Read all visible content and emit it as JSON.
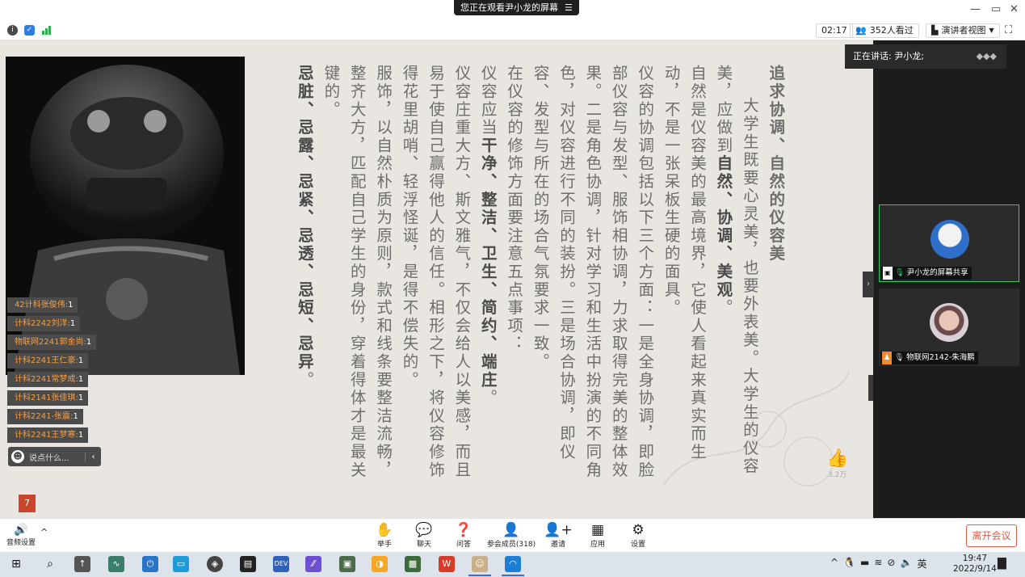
{
  "titlebar": {
    "share_notice": "您正在观看尹小龙的屏幕",
    "menu_glyph": "☰",
    "window_controls": [
      "—",
      "▭",
      "✕"
    ]
  },
  "toolbar": {
    "timer": "02:17",
    "viewers": "352人看过",
    "view_mode": "演讲者视图",
    "icons": [
      "info-icon",
      "shield-icon",
      "signal-icon",
      "fullscreen-icon"
    ],
    "colors": {
      "info": "#4a4a4a",
      "shield": "#2f7de1",
      "signal": "#2dae4f"
    }
  },
  "slide": {
    "title": "追求协调、自然的仪容美",
    "para1": [
      "大学生既要心灵美，也要外表美。大学生的仪容美，应做到",
      "自然、协调、美观",
      "。"
    ],
    "para2": "自然是仪容美的最高境界，它使人看起来真实而生动，不是一张呆板生硬的面具。",
    "para3": "仪容的协调包括以下三个方面：一是全身协调，即脸部仪容与发型、服饰相协调，力求取得完美的整体效果。二是角色协调，针对学习和生活中扮演的不同角色，对仪容进行不同的装扮。三是场合协调，即仪容、发型与所在的场合气氛要求一致。",
    "para4": "在仪容的修饰方面要注意五点事项：",
    "para5": [
      "仪容应当",
      "干净、整洁、卫生、简约、端庄",
      "。"
    ],
    "para6": "仪容庄重大方、斯文雅气，不仅会给人以美感，而且易于使自己赢得他人的信任。相形之下，将仪容修饰得花里胡哨、轻浮怪诞，是得不偿失的。",
    "para7": "服饰，以自然朴质为原则，款式和线条要整洁流畅，整齐大方，匹配自己学生的身份，穿着得体才是最关键的。",
    "para8": "忌脏、忌露、忌紧、忌透、忌短、忌异",
    "para8_tail": "。",
    "page_number": "7",
    "like_count": "3.2万"
  },
  "chat": {
    "items": [
      {
        "name": "42计科张俊伟:",
        "count": "1"
      },
      {
        "name": "计科2242刘洋:",
        "count": "1"
      },
      {
        "name": "物联网2241郭金尚:",
        "count": "1"
      },
      {
        "name": "计科2241王仁豪:",
        "count": "1"
      },
      {
        "name": "计科2241常梦成:",
        "count": "1"
      },
      {
        "name": "计科2141张佳琪:",
        "count": "1"
      },
      {
        "name": "计科2241-张震:",
        "count": "1"
      },
      {
        "name": "计科2241王梦寒:",
        "count": "1"
      }
    ],
    "input_placeholder": "说点什么..."
  },
  "participants": {
    "speaking": "正在讲话: 尹小龙;",
    "tiles": [
      {
        "name": "尹小龙的屏幕共享"
      },
      {
        "name": "物联网2142-朱海鹏"
      }
    ]
  },
  "controls": {
    "audio": "音频设置",
    "items": [
      {
        "label": "举手",
        "icon": "hand-icon"
      },
      {
        "label": "聊天",
        "icon": "chat-icon"
      },
      {
        "label": "问答",
        "icon": "question-icon"
      },
      {
        "label": "参会成员(318)",
        "icon": "members-icon"
      },
      {
        "label": "邀请",
        "icon": "invite-icon"
      },
      {
        "label": "应用",
        "icon": "apps-icon"
      },
      {
        "label": "设置",
        "icon": "settings-icon"
      }
    ],
    "leave": "离开会议"
  },
  "taskbar": {
    "tray_lang": "英",
    "time": "19:47",
    "date": "2022/9/14"
  }
}
